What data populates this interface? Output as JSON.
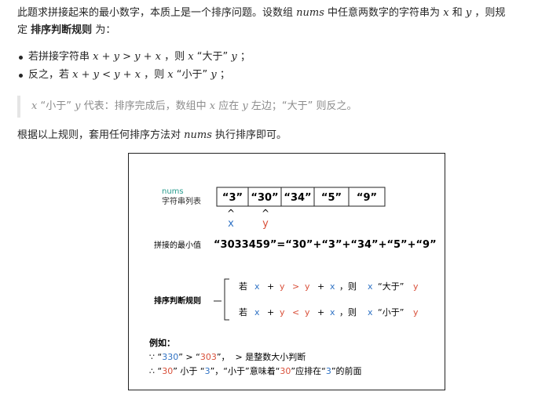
{
  "intro": {
    "line1_a": "此题求拼接起来的最小数字，本质上是一个排序问题。设数组",
    "nums": "nums",
    "line1_b": "中任意两数字的字符串为",
    "x": "x",
    "and": "和",
    "y": "y",
    "line1_c": "，则规",
    "line2_a": "定",
    "rule_name": "排序判断规则",
    "line2_b": "为："
  },
  "bullets": [
    {
      "a": "若拼接字符串",
      "expr": "x + y > y + x",
      "b": "，则",
      "x": "x",
      "c": "“大于”",
      "y": "y",
      "d": "；"
    },
    {
      "a": "反之，若",
      "expr": "x + y < y + x",
      "b": "，则",
      "x": "x",
      "c": "“小于”",
      "y": "y",
      "d": "；"
    }
  ],
  "quote": {
    "x": "x",
    "a": "“小于”",
    "y": "y",
    "b": "代表：排序完成后，数组中",
    "x2": "x",
    "c": "应在",
    "y2": "y",
    "d": "左边；“大于” 则反之。"
  },
  "para2": {
    "a": "根据以上规则，套用任何排序方法对",
    "nums": "nums",
    "b": "执行排序即可。"
  },
  "figure": {
    "nums_label": "nums",
    "list_label": "字符串列表",
    "cells": [
      "“3”",
      "“30”",
      "“34”",
      "“5”",
      "“9”"
    ],
    "caret": "^",
    "x_mark": "x",
    "y_mark": "y",
    "min_label": "拼接的最小值",
    "min_value": "“3033459”=“30”+“3”+“34”+“5”+“9”",
    "rule_label": "排序判断规则",
    "rule1": {
      "ruo": "若",
      "x": "x",
      "plus": "+",
      "y": "y",
      "op": ">",
      "y2": "y",
      "plus2": "+",
      "x2": "x",
      "then": "，则",
      "x3": "x",
      "rel": "“大于”",
      "y3": "y"
    },
    "rule2": {
      "ruo": "若",
      "x": "x",
      "plus": "+",
      "y": "y",
      "op": "<",
      "y2": "y",
      "plus2": "+",
      "x2": "x",
      "then": "，则",
      "x3": "x",
      "rel": "“小于”",
      "y3": "y"
    },
    "example_title": "例如：",
    "ex1": {
      "because": "∵",
      "q1": "“",
      "n1": "330",
      "q2": "”",
      ">": " > ",
      "q3": "“",
      "n2": "303",
      "q4": "”",
      "rest": "，  > 是整数大小判断"
    },
    "ex2": {
      "therefore": "∴",
      "q1": "“",
      "n1": "30",
      "q2": "”",
      "mid": " 小于 “",
      "n2": "3",
      "q3": "”，“小于”意味着“",
      "n3": "30",
      "q4": "”应排在“",
      "n4": "3",
      "tail": "”的前面"
    }
  },
  "colors": {
    "blue": "#2f72c4",
    "red": "#d9503a",
    "teal": "#2a9d8f",
    "text": "#262626",
    "muted": "#8c8c8c"
  }
}
